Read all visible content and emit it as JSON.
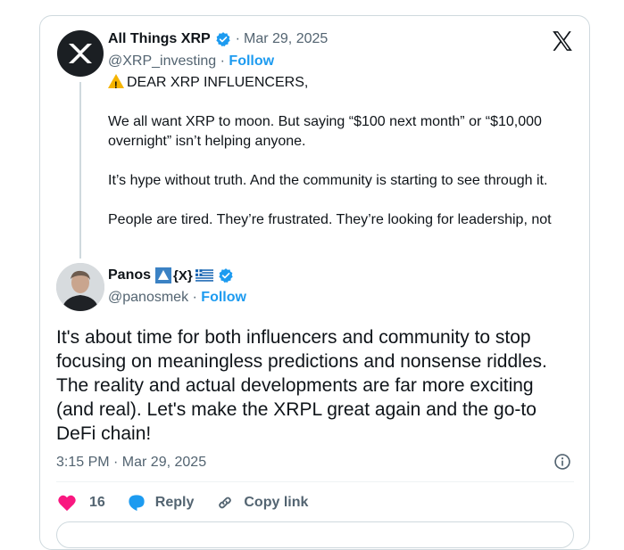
{
  "parent": {
    "name": "All Things XRP",
    "separator": "·",
    "date": "Mar 29, 2025",
    "handle": "@XRP_investing",
    "follow_sep": "·",
    "follow": "Follow",
    "lines": [
      "DEAR XRP INFLUENCERS,",
      "We all want XRP to moon. But saying “$100 next month” or “$10,000 overnight” isn’t helping anyone.",
      "It’s hype without truth. And the community is starting to see through it.",
      "People are tired. They’re frustrated. They’re looking for leadership, not"
    ]
  },
  "reply": {
    "name": "Panos",
    "badge_text": "{X}",
    "handle": "@panosmek",
    "follow_sep": "·",
    "follow": "Follow",
    "text": "It's about time for both influencers and community to stop focusing on meaningless predictions and nonsense riddles. The reality and actual developments are far more exciting (and real). Let's make the XRPL great again and the go-to DeFi chain!",
    "time": "3:15 PM · Mar 29, 2025"
  },
  "actions": {
    "likes": "16",
    "reply": "Reply",
    "copy": "Copy link"
  },
  "icons": {
    "brand": "x-logo-icon",
    "verified_color": "#1d9bf0",
    "like_color": "#f91880"
  }
}
